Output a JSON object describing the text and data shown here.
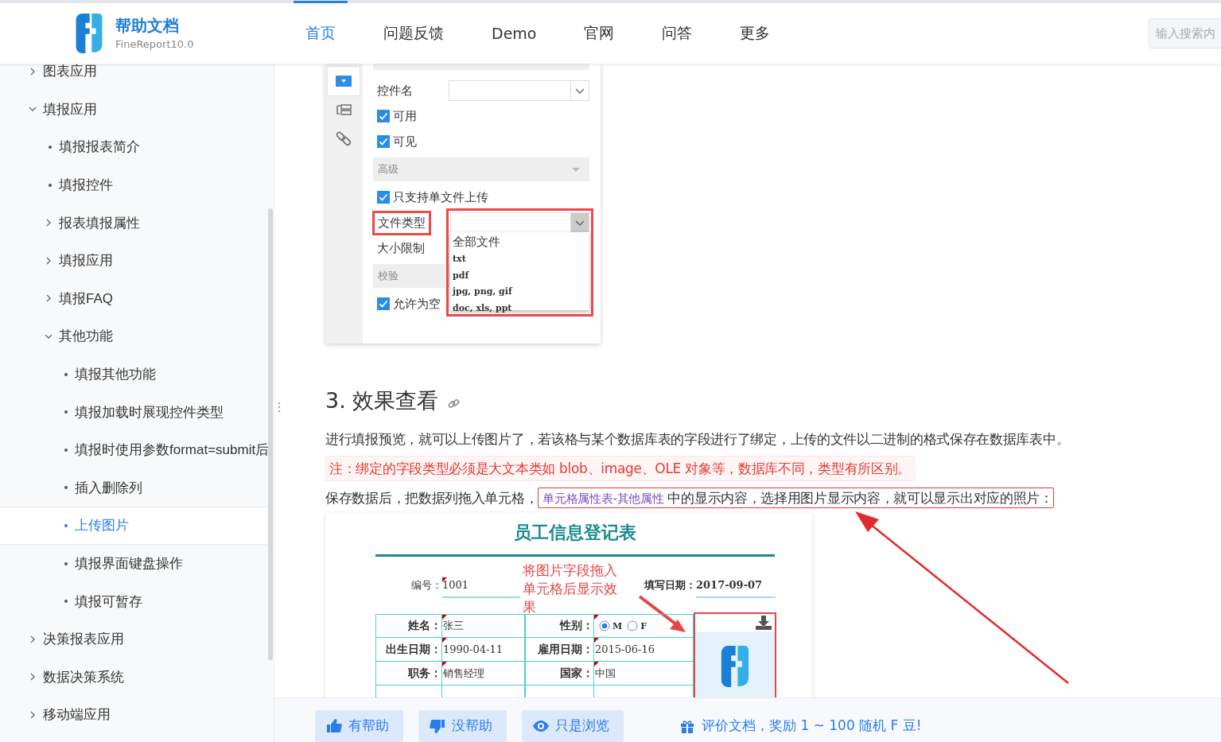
{
  "header": {
    "logo": {
      "title": "帮助文档",
      "subtitle": "FineReport10.0"
    },
    "nav": [
      {
        "label": "首页",
        "selected": true
      },
      {
        "label": "问题反馈",
        "selected": false
      },
      {
        "label": "Demo",
        "selected": false
      },
      {
        "label": "官网",
        "selected": false
      },
      {
        "label": "问答",
        "selected": false
      },
      {
        "label": "更多",
        "selected": false
      }
    ],
    "search": {
      "placeholder": "输入搜索内"
    }
  },
  "sidebar": {
    "items": [
      {
        "label": "图表应用",
        "kind": "folder",
        "expanded": false,
        "selected": false
      },
      {
        "label": "填报应用",
        "kind": "folder",
        "expanded": true,
        "selected": false,
        "children": [
          {
            "label": "填报报表简介",
            "kind": "leaf",
            "selected": false
          },
          {
            "label": "填报控件",
            "kind": "leaf",
            "selected": false
          },
          {
            "label": "报表填报属性",
            "kind": "folder",
            "expanded": false,
            "selected": false
          },
          {
            "label": "填报应用",
            "kind": "folder",
            "expanded": false,
            "selected": false
          },
          {
            "label": "填报FAQ",
            "kind": "folder",
            "expanded": false,
            "selected": false
          },
          {
            "label": "其他功能",
            "kind": "folder",
            "expanded": true,
            "selected": false,
            "children": [
              {
                "label": "填报其他功能",
                "kind": "leaf",
                "selected": false
              },
              {
                "label": "填报加载时展现控件类型",
                "kind": "leaf",
                "selected": false
              },
              {
                "label": "填报时使用参数format=submit后",
                "kind": "leaf",
                "selected": false
              },
              {
                "label": "插入删除列",
                "kind": "leaf",
                "selected": false
              },
              {
                "label": "上传图片",
                "kind": "leaf",
                "selected": true
              },
              {
                "label": "填报界面键盘操作",
                "kind": "leaf",
                "selected": false
              },
              {
                "label": "填报可暂存",
                "kind": "leaf",
                "selected": false
              }
            ]
          }
        ]
      },
      {
        "label": "决策报表应用",
        "kind": "folder",
        "expanded": false,
        "selected": false
      },
      {
        "label": "数据决策系统",
        "kind": "folder",
        "expanded": false,
        "selected": false
      },
      {
        "label": "移动端应用",
        "kind": "folder",
        "expanded": false,
        "selected": false
      }
    ]
  },
  "article": {
    "settings_screenshot": {
      "icon_tabs": [
        {
          "kind": "dropdown",
          "selected": true
        },
        {
          "kind": "list",
          "selected": false
        },
        {
          "kind": "link",
          "selected": false
        }
      ],
      "rows": [
        {
          "kind": "field",
          "label": "控件名",
          "highlighted": false,
          "open": false
        },
        {
          "kind": "checkbox",
          "label": "可用",
          "checked": true
        },
        {
          "kind": "checkbox",
          "label": "可见",
          "checked": true
        },
        {
          "kind": "section",
          "label": "高级"
        },
        {
          "kind": "checkbox",
          "label": "只支持单文件上传",
          "checked": true
        },
        {
          "kind": "field",
          "label": "文件类型",
          "highlighted": true,
          "open": true,
          "options": [
            "全部文件",
            "txt",
            "pdf",
            "jpg, png, gif",
            "doc, xls, ppt"
          ]
        },
        {
          "kind": "label",
          "label": "大小限制"
        },
        {
          "kind": "section",
          "label": "校验"
        },
        {
          "kind": "checkbox",
          "label": "允许为空",
          "checked": true
        }
      ]
    },
    "heading": "3. 效果查看",
    "paragraphs": [
      {
        "kind": "plain",
        "text": "进行填报预览，就可以上传图片了，若该格与某个数据库表的字段进行了绑定，上传的文件以二进制的格式保存在数据库表中。"
      },
      {
        "kind": "note",
        "text": "注：绑定的字段类型必须是大文本类如 blob、image、OLE 对象等，数据库不同，类型有所区别。"
      },
      {
        "kind": "linked",
        "before": "保存数据后，把数据列拖入单元格，",
        "link": "单元格属性表-其他属性",
        "after": " 中的显示内容，选择用图片显示内容，就可以显示出对应的照片："
      }
    ],
    "form_screenshot": {
      "title": "员工信息登记表",
      "annotation": "将图片字段拖入单元格后显示效果",
      "number_label": "编号：",
      "number": "1001",
      "date_label": "填写日期：",
      "date": "2017-09-07",
      "rows": [
        [
          {
            "kind": "text",
            "label": "姓名：",
            "value": "张三"
          },
          {
            "kind": "radio",
            "label": "性别：",
            "options": [
              {
                "label": "M",
                "selected": true
              },
              {
                "label": "F",
                "selected": false
              }
            ]
          }
        ],
        [
          {
            "kind": "text",
            "label": "出生日期：",
            "value": "1990-04-11"
          },
          {
            "kind": "text",
            "label": "雇用日期：",
            "value": "2015-06-16"
          }
        ],
        [
          {
            "kind": "text",
            "label": "职务：",
            "value": "销售经理"
          },
          {
            "kind": "text",
            "label": "国家：",
            "value": "中国"
          }
        ]
      ]
    }
  },
  "feedback": {
    "buttons": [
      {
        "kind": "like",
        "label": "有帮助"
      },
      {
        "kind": "dislike",
        "label": "没帮助"
      },
      {
        "kind": "view",
        "label": "只是浏览"
      }
    ],
    "reward": "评价文档，奖励 1 ~ 100 随机 F 豆!"
  }
}
